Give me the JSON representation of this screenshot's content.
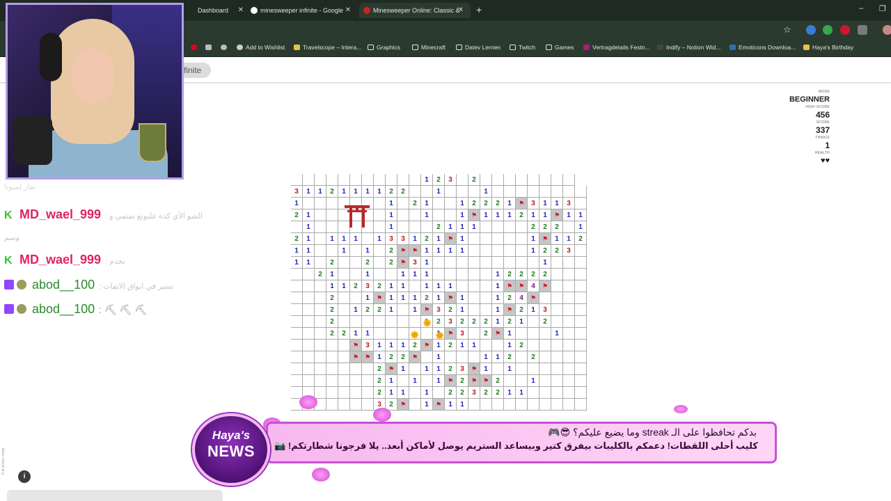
{
  "browser": {
    "tabs": [
      {
        "label": "Dashboard",
        "active": false
      },
      {
        "label": "minesweeper infinite - Google",
        "active": false
      },
      {
        "label": "Minesweeper Online: Classic &",
        "active": true
      }
    ],
    "new_tab": "+",
    "window_controls": [
      "–",
      "❐",
      "✕"
    ],
    "bookmarks": [
      {
        "label": "Add to Wishlist",
        "icon": "bookmark-icon"
      },
      {
        "label": "Travelscope – Intera...",
        "icon": "travelscope-icon"
      },
      {
        "label": "Graphics",
        "icon": "folder-icon"
      },
      {
        "label": "Minecraft",
        "icon": "folder-icon"
      },
      {
        "label": "Datev Lernen",
        "icon": "folder-icon"
      },
      {
        "label": "Twitch",
        "icon": "folder-icon"
      },
      {
        "label": "Games",
        "icon": "folder-icon"
      },
      {
        "label": "Vertragdetails Festn...",
        "icon": "bookmark-icon"
      },
      {
        "label": "Indify – Notion Wid...",
        "icon": "bookmark-icon"
      },
      {
        "label": "Emoticons Downloa...",
        "icon": "bookmark-icon"
      },
      {
        "label": "Haya's Birthday",
        "icon": "bookmark-icon"
      }
    ]
  },
  "game": {
    "chip_label": "finite",
    "stats": {
      "mode_label": "MODE",
      "mode": "BEGINNER",
      "high_score_label": "HIGH SCORE",
      "high_score": "456",
      "score_label": "SCORE",
      "score": "337",
      "things_label": "THINGS",
      "things": "1",
      "health_label": "HEALTH",
      "health": "♥♥"
    }
  },
  "chat": {
    "header": "تقار لمبونا",
    "messages": [
      {
        "user": "MD_wael_999",
        "text": ": الشو الأي كده عليونغ تمتمي و",
        "cont": "وسم",
        "badge": "k"
      },
      {
        "user": "MD_wael_999",
        "text": ": تخدم",
        "badge": "k"
      },
      {
        "user": "abod__100",
        "text": ": تسير في ابواق الاتفات",
        "badge": "twitch"
      },
      {
        "user": "abod__100",
        "text": ": ⛏ ⛏ ⛏",
        "badge": "twitch"
      }
    ]
  },
  "news": {
    "badge_line1": "Haya's",
    "badge_line2": "NEWS",
    "line1": "بدكم تحافظوا على الـ streak وما يضيع عليكم؟ 😎🎮",
    "line2": "كليب أحلى اللقطات! دعمكم بالكليبات بيفرق كتير وبيساعد الستريم يوصل لأماكن أبعد.. يلا فرجونا شطارتكم! 📷✨"
  },
  "footer": {
    "info": "i",
    "fullscreen_note": "Full screen mode"
  },
  "colors": {
    "accent": "#c84fd6",
    "num1": "#2222bb",
    "num2": "#1a7a1a",
    "num3": "#c31818",
    "num4": "#7a1a8a"
  },
  "board": {
    "rows": [
      {
        "r": 0,
        "cells": "...........123.2........"
      },
      {
        "r": 1,
        "cells": "3112111122..1...1........"
      },
      {
        "r": 2,
        "cells": "1.......1.21..12221F3113."
      },
      {
        "r": 3,
        "cells": "21......1..1..1F111211F11"
      },
      {
        "r": 4,
        "cells": ".1......1...2111....222.1"
      },
      {
        "r": 5,
        "cells": "21.111.133121F1.....1F112"
      },
      {
        "r": 6,
        "cells": "11..1.1.2FF1111.....1223."
      },
      {
        "r": 7,
        "cells": "11.2..2.2F31.........1..."
      },
      {
        "r": 8,
        "cells": "..21..1..111.....12222..."
      },
      {
        "r": 9,
        "cells": "...1123211.111...1FF4F..."
      },
      {
        "r": 10,
        "cells": "...2..1F11121F1..124F...."
      },
      {
        "r": 11,
        "cells": "...2.1221.1F321..1F213..."
      },
      {
        "r": 12,
        "cells": "...2.......123222121.2..."
      },
      {
        "r": 13,
        "cells": "...2211.....1F3.2F1...1.."
      },
      {
        "r": 14,
        "cells": ".....F31112F1211..12....."
      },
      {
        "r": 15,
        "cells": ".....FF122F.1...112.2...."
      },
      {
        "r": 16,
        "cells": ".......2F1.1123F1.1......"
      },
      {
        "r": 17,
        "cells": ".......21.1.1F2FF2..1...."
      },
      {
        "r": 18,
        "cells": ".......211.1.2232211....."
      },
      {
        "r": 19,
        "cells": ".......32F.1F11.........."
      }
    ]
  }
}
